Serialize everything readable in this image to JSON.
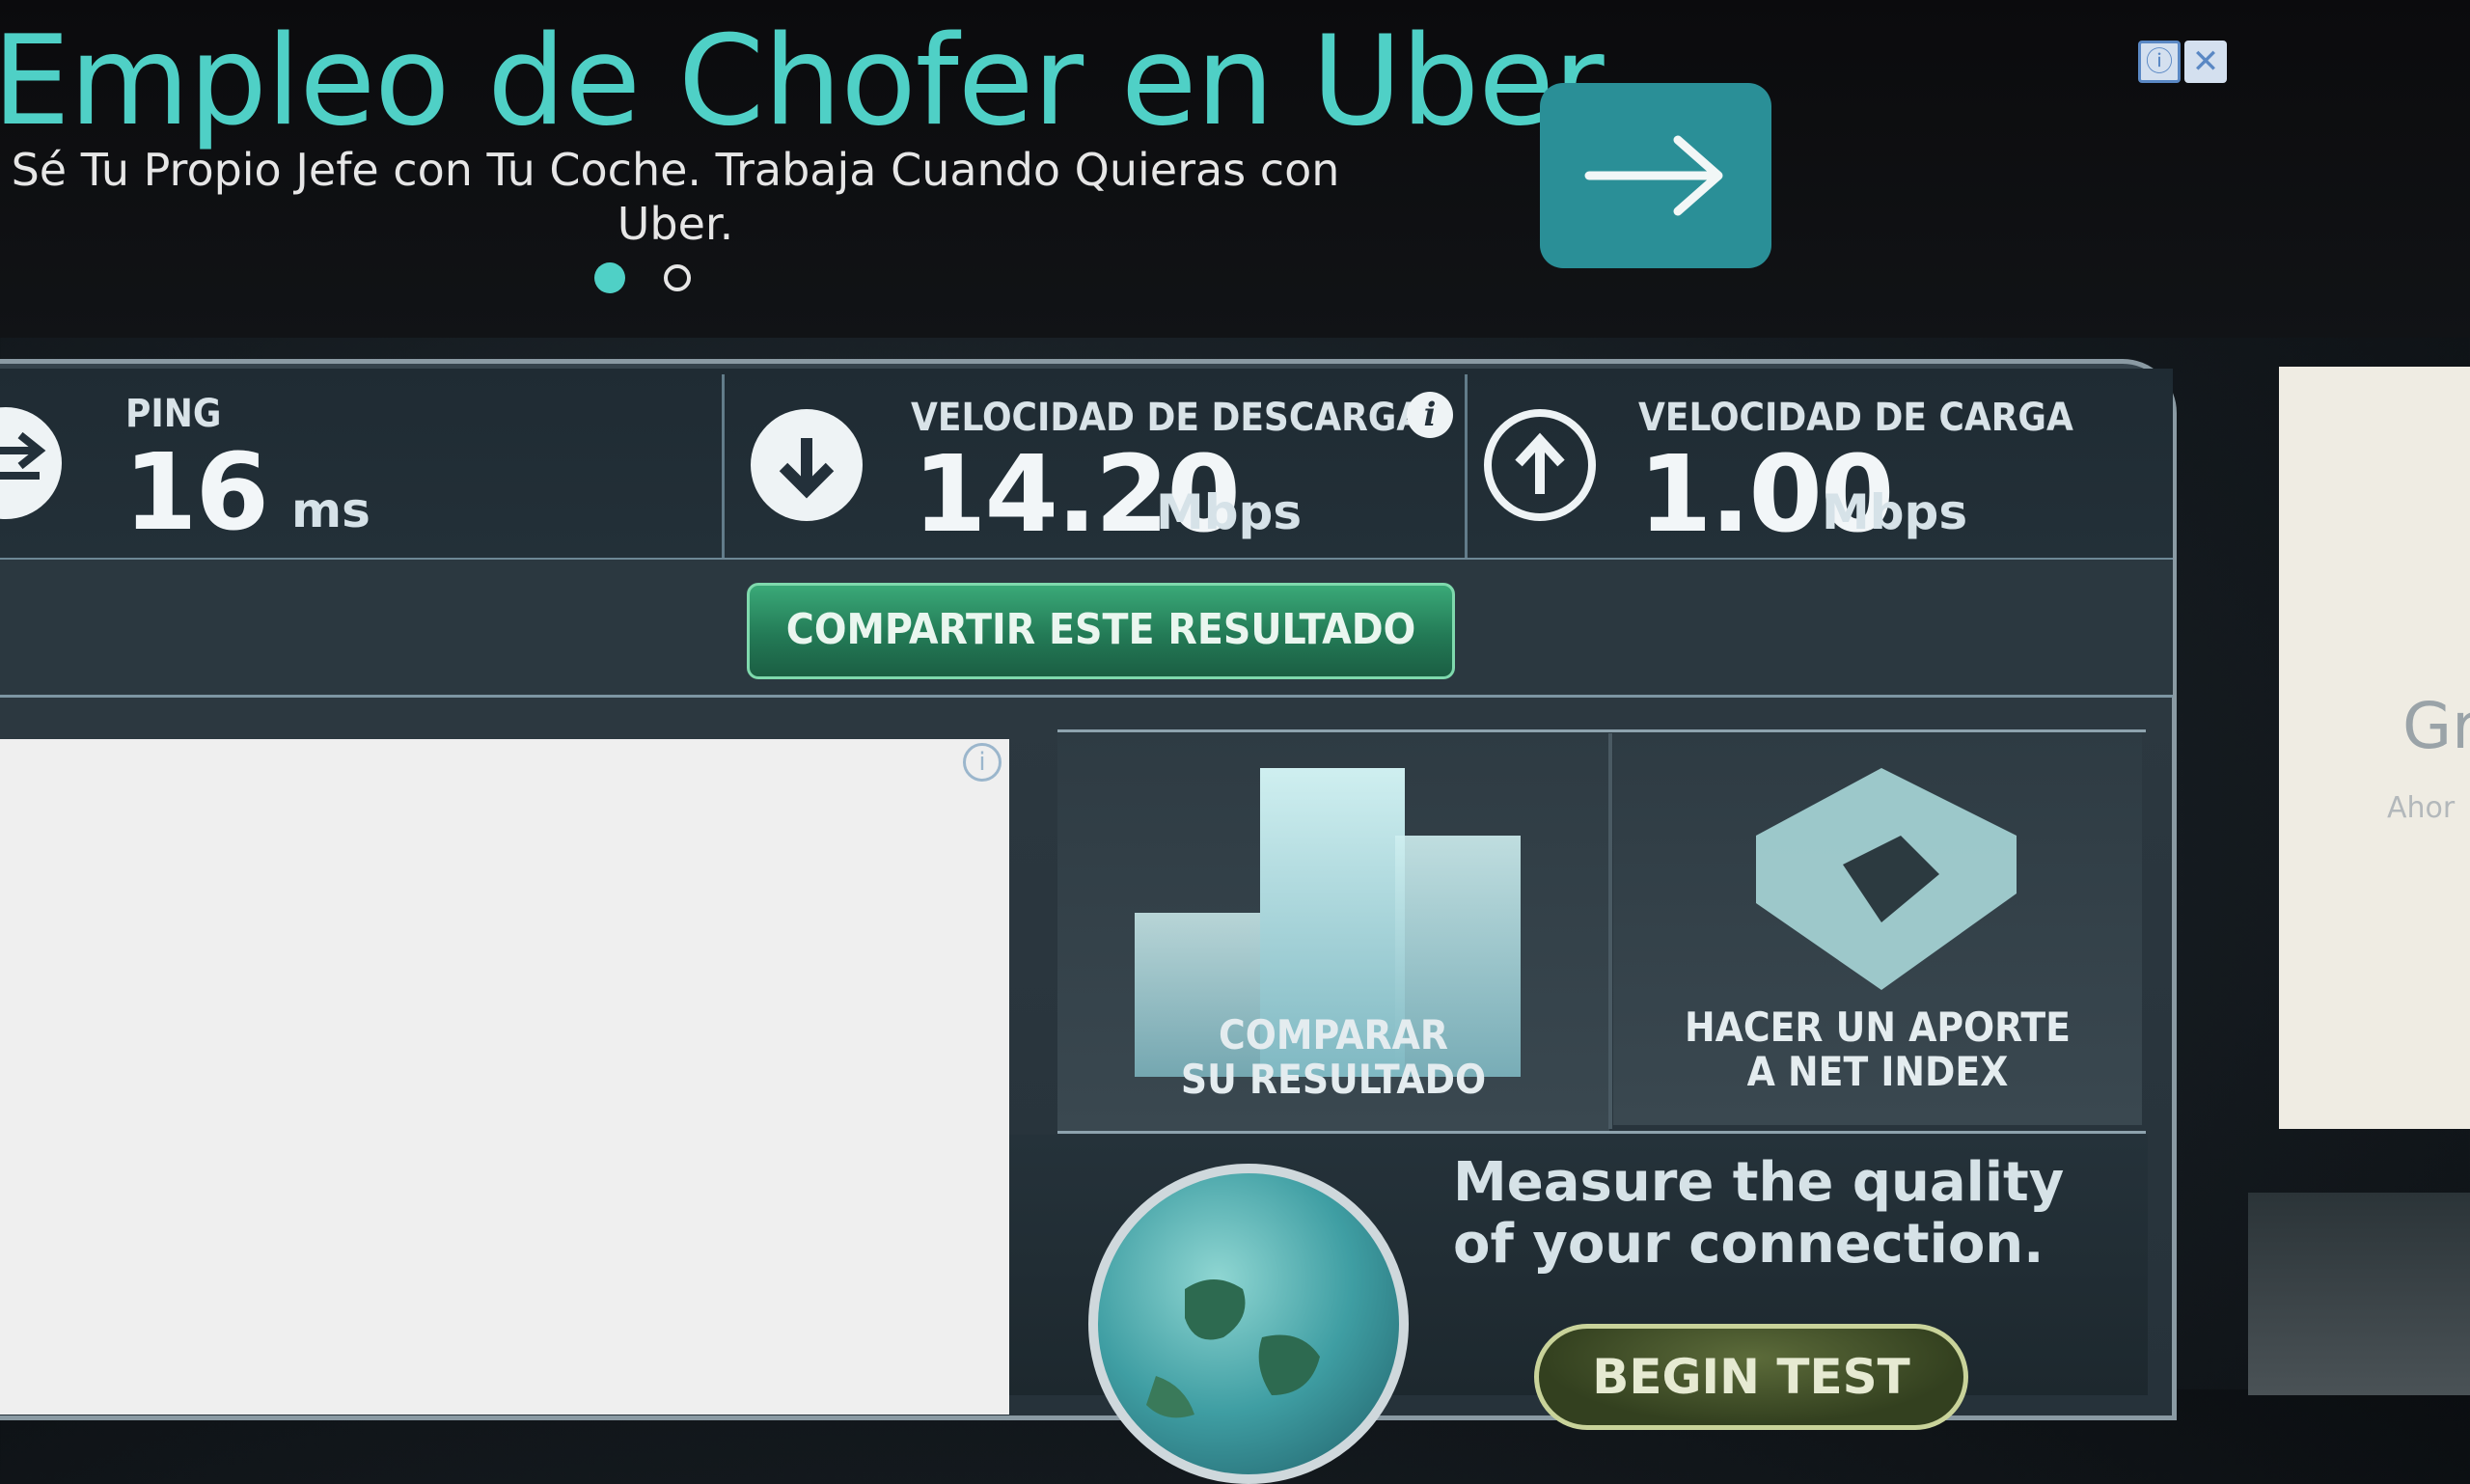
{
  "ad": {
    "title": "Empleo de Chofer en Uber",
    "subtitle": "Sé Tu Propio Jefe con Tu Coche. Trabaja Cuando Quieras con Uber.",
    "info_glyph": "ⓘ",
    "close_glyph": "✕",
    "accent_color": "#4fd0c6"
  },
  "results": {
    "ping": {
      "label": "PING",
      "value": "16",
      "unit": "ms"
    },
    "download": {
      "label": "VELOCIDAD DE DESCARGA",
      "value": "14.20",
      "unit": "Mbps",
      "info_glyph": "i"
    },
    "upload": {
      "label": "VELOCIDAD DE CARGA",
      "value": "1.00",
      "unit": "Mbps"
    }
  },
  "share_button": "COMPARTIR ESTE RESULTADO",
  "left_ad": {
    "info_glyph": "i"
  },
  "tiles": {
    "compare": {
      "line1": "COMPARAR",
      "line2": "SU RESULTADO"
    },
    "contribute": {
      "line1": "HACER UN APORTE",
      "line2": "A NET INDEX"
    }
  },
  "measure": {
    "text": "Measure the quality of your connection.",
    "button": "BEGIN TEST"
  },
  "right_ad": {
    "text": "Gr",
    "small": "Ahor"
  },
  "colors": {
    "share_green": "#2f9a6a",
    "ad_button": "#2a8f97"
  }
}
